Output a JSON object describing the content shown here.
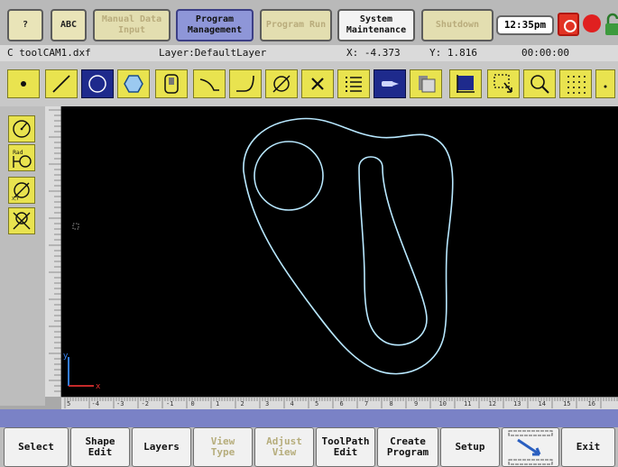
{
  "topbar": {
    "help_label": "?",
    "abc_label": "ABC",
    "manual_data_input_label": "Manual Data\nInput",
    "program_management_label": "Program\nManagement",
    "program_run_label": "Program Run",
    "system_maintenance_label": "System\nMaintenance",
    "shutdown_label": "Shutdown",
    "clock": "12:35pm"
  },
  "status": {
    "file": "C toolCAM1.dxf",
    "layer": "Layer:DefaultLayer",
    "x_readout": "X: -4.373",
    "y_readout": "Y: 1.816",
    "timer": "00:00:00"
  },
  "toolbar": {
    "tools": [
      "point-icon",
      "line-icon",
      "circle-icon",
      "polygon-icon",
      "rounded-rect-icon",
      "arc-right-icon",
      "arc-corner-icon",
      "diameter-icon",
      "delete-icon",
      "list-icon",
      "tool-icon",
      "camera-icon",
      "select-region-icon",
      "select-arrow-icon",
      "zoom-icon",
      "grid-icon"
    ],
    "selected_tool": "circle-icon"
  },
  "left_tools": [
    "dimension-radius-icon",
    "dimension-rad-icon",
    "dimension-xy-icon",
    "dimension-clear-icon"
  ],
  "axes": {
    "x_label": "x",
    "y_label": "y"
  },
  "ruler": {
    "x_ticks": [
      "5",
      "-4",
      "-3",
      "-2",
      "-1",
      "0",
      "1",
      "2",
      "3",
      "4",
      "5",
      "6",
      "7",
      "8",
      "9",
      "10",
      "11",
      "12",
      "13",
      "14",
      "15",
      "16"
    ]
  },
  "softkeys": {
    "select_label": "Select",
    "shape_edit_label": "Shape\nEdit",
    "layers_label": "Layers",
    "view_type_label": "View\nType",
    "adjust_view_label": "Adjust\nView",
    "toolpath_edit_label": "ToolPath\nEdit",
    "create_program_label": "Create\nProgram",
    "setup_label": "Setup",
    "exit_label": "Exit"
  },
  "colors": {
    "tool_yellow": "#e9e34f",
    "selected_tool": "#1e2a8c",
    "active_menu": "#8e96d8",
    "canvas_bg": "#000000",
    "geometry": "#b8e8ff"
  }
}
